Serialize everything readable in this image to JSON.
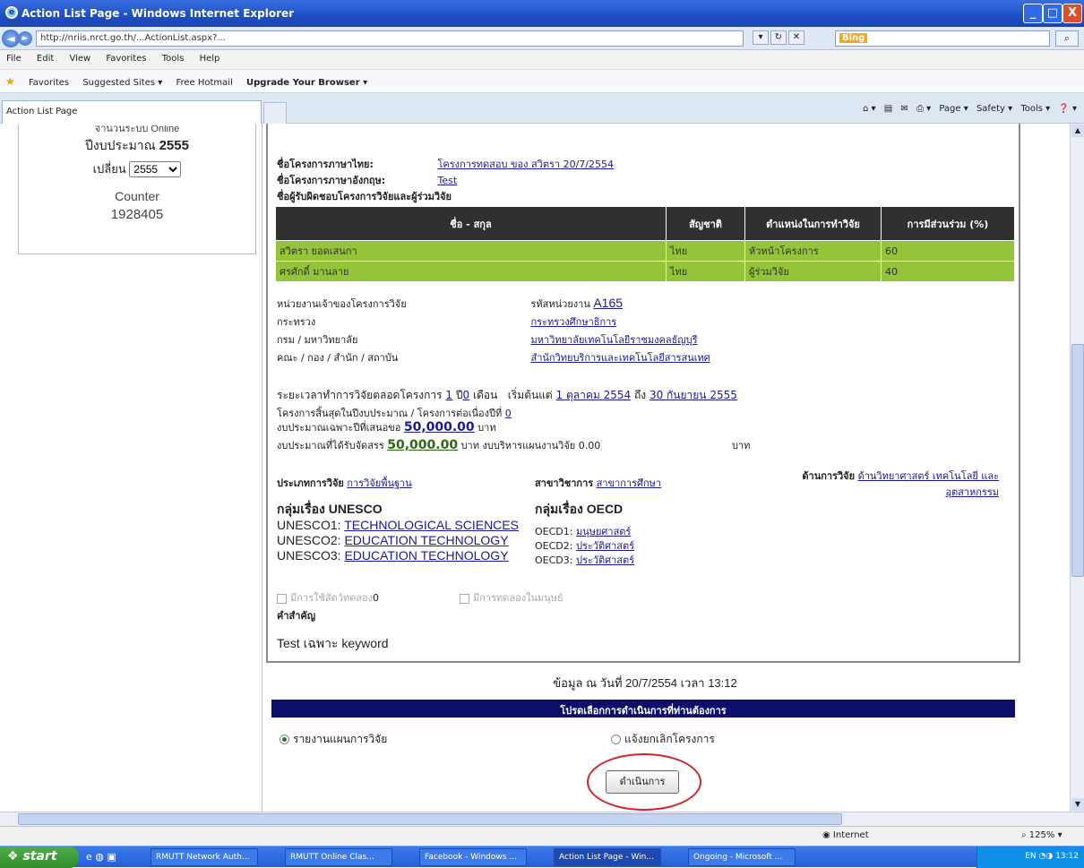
{
  "window": {
    "title": "Action List Page - Windows Internet Explorer",
    "minimize": "_",
    "maximize": "□",
    "close": "X"
  },
  "address": {
    "url": "http://nriis.nrct.go.th/...ActionList.aspx?...",
    "search_engine": "Bing",
    "nav_back": "◄",
    "nav_fwd": "►"
  },
  "menu": [
    "File",
    "Edit",
    "View",
    "Favorites",
    "Tools",
    "Help"
  ],
  "favorites": {
    "label": "Favorites",
    "items": [
      "Suggested Sites ▾",
      "Free Hotmail",
      "Upgrade Your Browser ▾"
    ]
  },
  "tab": {
    "label": "Action List Page"
  },
  "commands": [
    "Page ▾",
    "Safety ▾",
    "Tools ▾"
  ],
  "sidebar": {
    "top_text": "จำนวนระบบ Online",
    "year_label": "ปีงบประมาณ",
    "year_value": "2555",
    "change_label": "เปลี่ยน",
    "select_value": "2555",
    "counter_label": "Counter",
    "counter_value": "1928405"
  },
  "project": {
    "th_name_label": "ชื่อโครงการภาษาไทย:",
    "th_name": "โครงการทดสอบ ของ สวิตรา 20/7/2554",
    "en_name_label": "ชื่อโครงการภาษาอังกฤษ:",
    "en_name": "Test",
    "team_label": "ชื่อผู้รับผิดชอบโครงการวิจัยและผู้ร่วมวิจัย",
    "table": {
      "headers": [
        "ชื่อ - สกุล",
        "สัญชาติ",
        "ตำแหน่งในการทำวิจัย",
        "การมีส่วนร่วม (%)"
      ],
      "rows": [
        [
          "สวิตรา ยอดเสนกา",
          "ไทย",
          "หัวหน้าโครงการ",
          "60"
        ],
        [
          "ศรศักดิ์ มานลาย",
          "ไทย",
          "ผู้ร่วมวิจัย",
          "40"
        ]
      ]
    },
    "org": [
      {
        "label": "หน่วยงานเจ้าของโครงการวิจัย",
        "value_label": "รหัสหน่วยงาน",
        "value": "A165"
      },
      {
        "label": "กระทรวง",
        "value": "กระทรวงศึกษาธิการ"
      },
      {
        "label": "กรม / มหาวิทยาลัย",
        "value": "มหาวิทยาลัยเทคโนโลยีราชมงคลธัญบุรี"
      },
      {
        "label": "คณะ / กอง / สำนัก / สถาบัน",
        "value": "สำนักวิทยบริการและเทคโนโลยีสารสนเทศ"
      }
    ],
    "duration": {
      "text1": "ระยะเวลาทำการวิจัยตลอดโครงการ",
      "years": "1",
      "unit_y": "ปี",
      "months": "0",
      "unit_m": "เดือน",
      "start_label": "เริ่มต้นแต่",
      "start": "1 ตุลาคม 2554",
      "to": "ถึง",
      "end": "30 กันยายน 2555"
    },
    "single_year": {
      "text": "โครงการสิ้นสุดในปีงบประมาณ / โครงการต่อเนื่องปีที่",
      "value": "0"
    },
    "budget_year": {
      "label": "งบประมาณเฉพาะปีที่เสนอขอ",
      "value": "50,000.00",
      "unit": "บาท"
    },
    "budget_alloc": {
      "label": "งบประมาณที่ได้รับจัดสรร",
      "value": "50,000.00",
      "unit": "บาท",
      "admin_label": "งบบริหารแผนงานวิจัย",
      "admin_value": "0.00",
      "admin_unit": "บาท"
    },
    "type": {
      "label": "ประเภทการวิจัย",
      "value": "การวิจัยพื้นฐาน"
    },
    "branch": {
      "label": "สาขาวิชาการ",
      "value": "สาขาการศึกษา"
    },
    "field": {
      "label": "ด้านการวิจัย",
      "value": "ด้านวิทยาศาสตร์ เทคโนโลยี และอุตสาหกรรม"
    },
    "unesco": {
      "title": "กลุ่มเรื่อง UNESCO",
      "items": [
        {
          "k": "UNESCO1:",
          "v": "TECHNOLOGICAL SCIENCES"
        },
        {
          "k": "UNESCO2:",
          "v": "EDUCATION TECHNOLOGY"
        },
        {
          "k": "UNESCO3:",
          "v": "EDUCATION TECHNOLOGY"
        }
      ]
    },
    "oecd": {
      "title": "กลุ่มเรื่อง OECD",
      "items": [
        {
          "k": "OECD1:",
          "v": "มนุษยศาสตร์"
        },
        {
          "k": "OECD2:",
          "v": "ประวัติศาสตร์"
        },
        {
          "k": "OECD3:",
          "v": "ประวัติศาสตร์"
        }
      ]
    },
    "chk1": {
      "label": "มีการใช้สัตว์ทดลอง",
      "count": "0"
    },
    "chk2": {
      "label": "มีการทดลองในมนุษย์"
    },
    "keyword_label": "คำสำคัญ",
    "keyword_value": "Test เฉพาะ keyword"
  },
  "footer": {
    "date_text": "ข้อมูล ณ วันที่ 20/7/2554 เวลา 13:12",
    "options_header": "โปรดเลือกการดำเนินการที่ท่านต้องการ",
    "opt1": "รายงานแผนการวิจัย",
    "opt2": "แจ้งยกเลิกโครงการ",
    "go": "ดำเนินการ"
  },
  "status": {
    "zone": "Internet",
    "zoom": "125%"
  },
  "taskbar": {
    "start": "start",
    "tasks": [
      "RMUTT Network Auth...",
      "RMUTT Online Clas...",
      "Facebook - Windows ...",
      "Action List Page - Win...",
      "Ongoing - Microsoft ..."
    ],
    "clock": "13:12",
    "lang": "EN"
  }
}
